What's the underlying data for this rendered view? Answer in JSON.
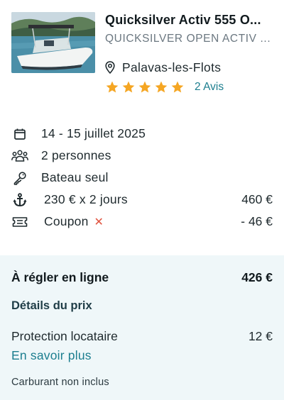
{
  "listing": {
    "title": "Quicksilver Activ 555 O...",
    "subtitle": "QUICKSILVER OPEN ACTIV ...",
    "location": "Palavas-les-Flots",
    "rating_stars": 5,
    "reviews_label": "2 Avis",
    "star_color": "#f5a623"
  },
  "booking": {
    "dates": "14 - 15 juillet 2025",
    "people": "2 personnes",
    "rental_type": "Bateau seul",
    "price_line": "230 € x 2 jours",
    "price_total": "460 €",
    "coupon_label": "Coupon",
    "coupon_remove": "✕",
    "coupon_value": "- 46 €"
  },
  "payment": {
    "online_label": "À régler en ligne",
    "online_total": "426 €",
    "details_title": "Détails du prix",
    "protection_label": "Protection locataire",
    "protection_value": "12 €",
    "learn_more": "En savoir plus",
    "fuel_note": "Carburant non inclus"
  },
  "colors": {
    "accent": "#1c7e8f",
    "remove": "#e0533f",
    "panel_bg": "#eff7f9"
  }
}
